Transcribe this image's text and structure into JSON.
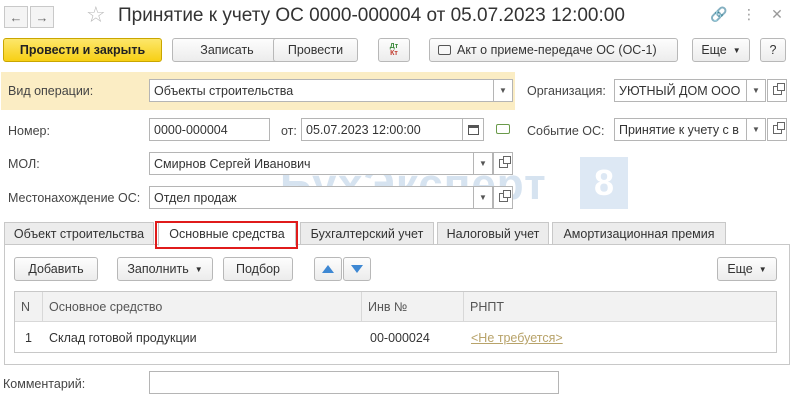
{
  "window": {
    "title": "Принятие к учету ОС 0000-000004 от 05.07.2023 12:00:00",
    "back_icon": "arrow-left",
    "forward_icon": "arrow-right",
    "favorite_icon": "star",
    "link_icon": "link",
    "more_icon": "vertical-dots",
    "close_icon": "close-x"
  },
  "toolbar": {
    "post_close": "Провести и закрыть",
    "write": "Записать",
    "post": "Провести",
    "dtkt_top": "Дт",
    "dtkt_bottom": "Кт",
    "print_act": "Акт о приеме-передаче ОС (ОС-1)",
    "more": "Еще",
    "help": "?"
  },
  "form": {
    "operation_label": "Вид операции:",
    "operation_value": "Объекты строительства",
    "org_label": "Организация:",
    "org_value": "УЮТНЫЙ ДОМ ООО",
    "number_label": "Номер:",
    "number_value": "0000-000004",
    "date_label": "от:",
    "date_value": "05.07.2023 12:00:00",
    "event_label": "Событие ОС:",
    "event_value": "Принятие к учету с в",
    "mol_label": "МОЛ:",
    "mol_value": "Смирнов Сергей Иванович",
    "location_label": "Местонахождение ОС:",
    "location_value": "Отдел продаж",
    "comment_label": "Комментарий:",
    "comment_value": ""
  },
  "watermark": {
    "text": "БухЭксперт",
    "badge": "8"
  },
  "tabs": [
    {
      "label": "Объект строительства",
      "active": false
    },
    {
      "label": "Основные средства",
      "active": true
    },
    {
      "label": "Бухгалтерский учет",
      "active": false
    },
    {
      "label": "Налоговый учет",
      "active": false
    },
    {
      "label": "Амортизационная премия",
      "active": false
    }
  ],
  "table_toolbar": {
    "add": "Добавить",
    "fill": "Заполнить",
    "pick": "Подбор",
    "more": "Еще"
  },
  "table": {
    "columns": [
      "N",
      "Основное средство",
      "Инв №",
      "РНПТ"
    ],
    "rows": [
      {
        "n": "1",
        "asset": "Склад готовой продукции",
        "inv": "00-000024",
        "rnpt": "<Не требуется>"
      }
    ]
  },
  "colors": {
    "primary_button": "#f7cf14",
    "highlight_row": "#fbedc4",
    "active_tab_border": "#e01b1b",
    "link": "#b8a36a",
    "arrow": "#3e88d3"
  }
}
